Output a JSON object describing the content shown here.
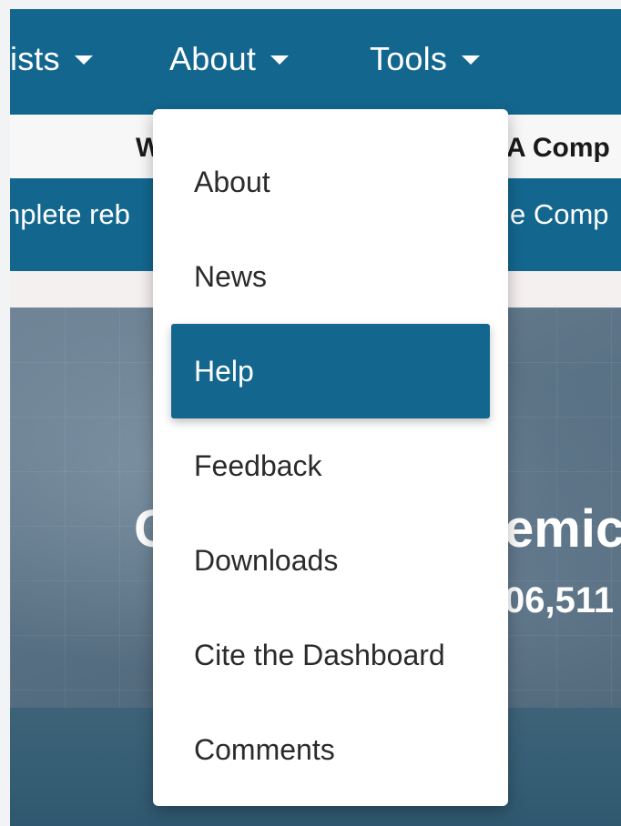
{
  "navbar": {
    "items": [
      {
        "label": "ists"
      },
      {
        "label": "About"
      },
      {
        "label": "Tools"
      }
    ]
  },
  "banner": {
    "left_fragment": "W",
    "right_fragment": "A Comp"
  },
  "announcement": {
    "left_fragment": "nplete reb",
    "right_fragment": "e Comp"
  },
  "hero": {
    "title_left": "C",
    "title_right": "emic",
    "count_fragment": "06,511"
  },
  "dropdown": {
    "items": [
      {
        "label": "About"
      },
      {
        "label": "News"
      },
      {
        "label": "Help",
        "active": true
      },
      {
        "label": "Feedback"
      },
      {
        "label": "Downloads"
      },
      {
        "label": "Cite the Dashboard"
      },
      {
        "label": "Comments"
      }
    ]
  },
  "colors": {
    "primary": "#13678f",
    "banner_bg": "#f7f7f7"
  }
}
